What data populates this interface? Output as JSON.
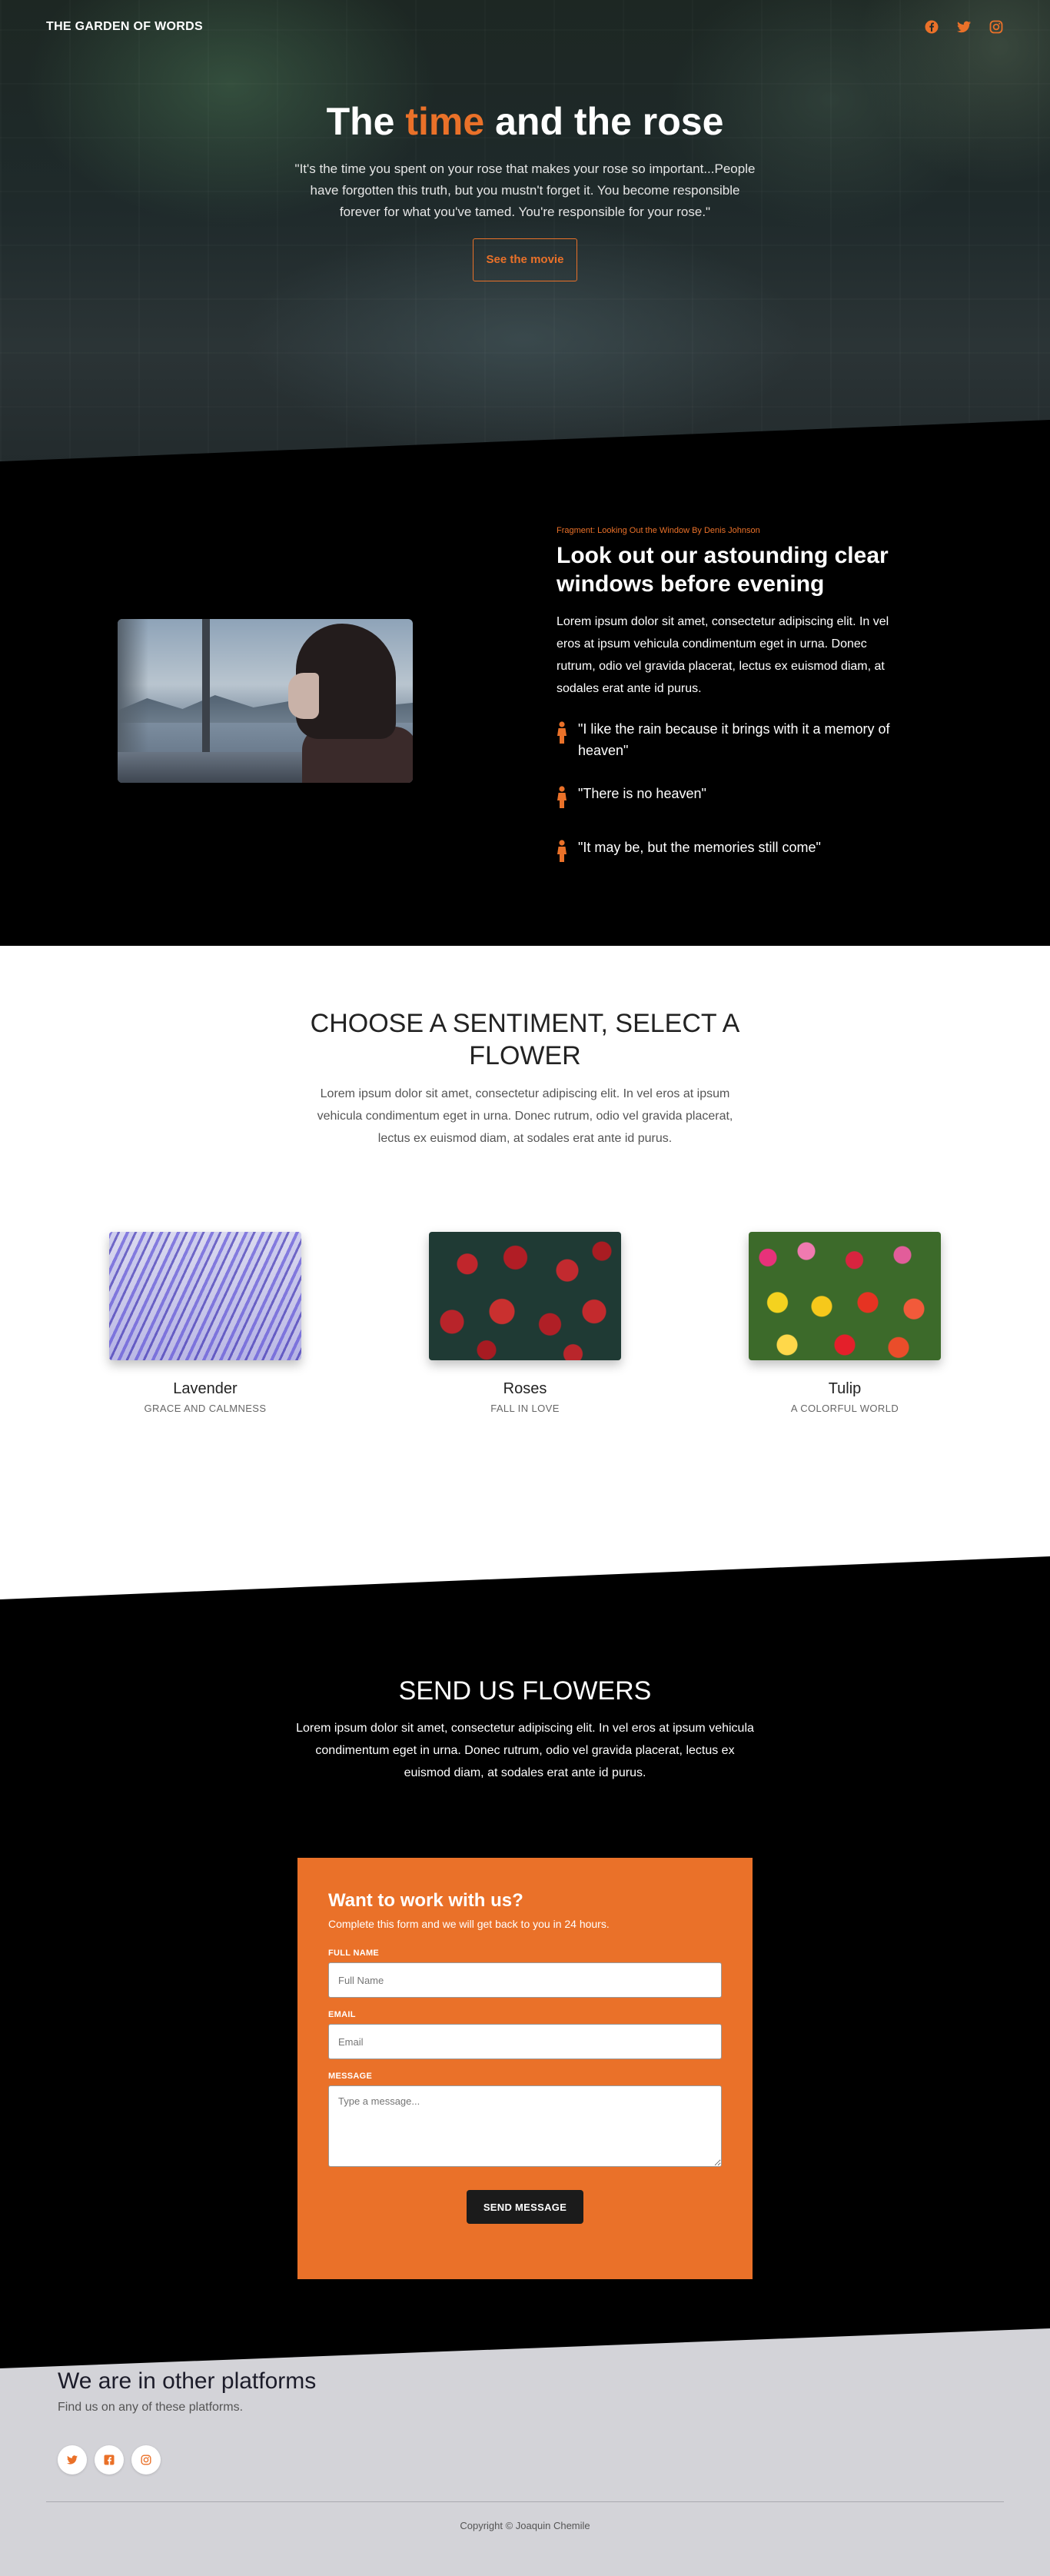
{
  "nav": {
    "brand": "THE GARDEN OF WORDS",
    "social_icons": [
      "facebook-icon",
      "twitter-icon",
      "instagram-icon"
    ]
  },
  "hero": {
    "title_before": "The",
    "title_accent": "time",
    "title_after": "and the rose",
    "quote": "\"It's the time you spent on your rose that makes your rose so important...People have forgotten this truth, but you mustn't forget it. You become responsible forever for what you've tamed. You're responsible for your rose.\"",
    "button_label": "See the movie"
  },
  "fragment": {
    "label": "Fragment: Looking Out the Window By Denis Johnson",
    "heading": "Look out our astounding clear windows before evening",
    "body": "Lorem ipsum dolor sit amet, consectetur adipiscing elit. In vel eros at ipsum vehicula condimentum eget in urna. Donec rutrum, odio vel gravida placerat, lectus ex euismod diam, at sodales erat ante id purus.",
    "quotes": [
      "\"I like the rain because it brings with it a memory of heaven\"",
      "\"There is no heaven\"",
      "\"It may be, but the memories still come\""
    ]
  },
  "sentiment": {
    "title": "CHOOSE A SENTIMENT, SELECT A FLOWER",
    "description": "Lorem ipsum dolor sit amet, consectetur adipiscing elit. In vel eros at ipsum vehicula condimentum eget in urna. Donec rutrum, odio vel gravida placerat, lectus ex euismod diam, at sodales erat ante id purus.",
    "flowers": [
      {
        "name": "Lavender",
        "subtitle": "GRACE AND CALMNESS"
      },
      {
        "name": "Roses",
        "subtitle": "FALL IN LOVE"
      },
      {
        "name": "Tulip",
        "subtitle": "A COLORFUL WORLD"
      }
    ]
  },
  "send": {
    "title": "SEND US FLOWERS",
    "description": "Lorem ipsum dolor sit amet, consectetur adipiscing elit. In vel eros at ipsum vehicula condimentum eget in urna. Donec rutrum, odio vel gravida placerat, lectus ex euismod diam, at sodales erat ante id purus.",
    "form": {
      "title": "Want to work with us?",
      "subtitle": "Complete this form and we will get back to you in 24 hours.",
      "fields": {
        "full_name": {
          "label": "FULL NAME",
          "placeholder": "Full Name",
          "value": ""
        },
        "email": {
          "label": "EMAIL",
          "placeholder": "Email",
          "value": ""
        },
        "message": {
          "label": "MESSAGE",
          "placeholder": "Type a message...",
          "value": ""
        }
      },
      "submit_label": "SEND MESSAGE"
    }
  },
  "footer": {
    "title": "We are in other platforms",
    "subtitle": "Find us on any of these platforms.",
    "social_icons": [
      "twitter-icon",
      "facebook-icon",
      "instagram-icon"
    ],
    "copyright": "Copyright © Joaquin Chemile"
  },
  "colors": {
    "accent": "#ea7129",
    "dark": "#000000",
    "footer_bg": "#d3d3d8",
    "button_dark": "#1b1b1b"
  }
}
